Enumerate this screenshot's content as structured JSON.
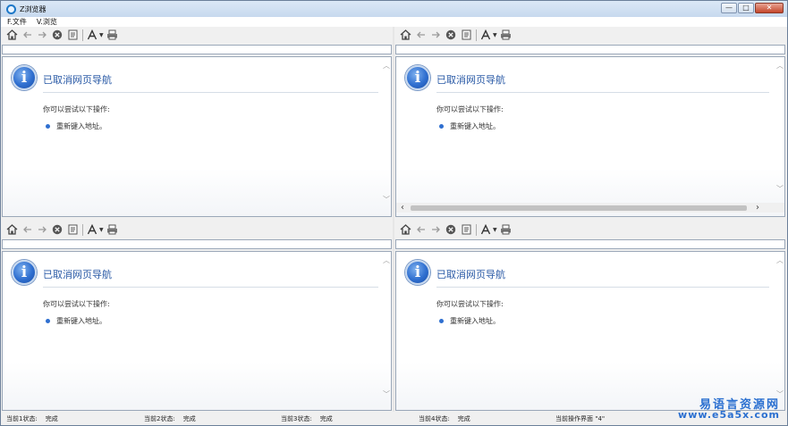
{
  "window": {
    "title": "Z浏览器",
    "buttons": {
      "minimize": "—",
      "maximize": "□",
      "close": "✕"
    }
  },
  "menubar": [
    {
      "label": "F.文件"
    },
    {
      "label": "V.浏览"
    }
  ],
  "panes": [
    {
      "message": {
        "title": "已取消网页导航",
        "hint": "你可以尝试以下操作:",
        "action": "重新键入地址。"
      }
    },
    {
      "message": {
        "title": "已取消网页导航",
        "hint": "你可以尝试以下操作:",
        "action": "重新键入地址。"
      }
    },
    {
      "message": {
        "title": "已取消网页导航",
        "hint": "你可以尝试以下操作:",
        "action": "重新键入地址。"
      }
    },
    {
      "message": {
        "title": "已取消网页导航",
        "hint": "你可以尝试以下操作:",
        "action": "重新键入地址。"
      }
    }
  ],
  "icons": {
    "home": "home-icon",
    "back": "back-arrow-icon",
    "forward": "forward-arrow-icon",
    "stop": "stop-icon",
    "page": "page-icon",
    "font": "font-size-icon",
    "print": "print-icon",
    "info": "info-icon"
  },
  "statusbar": [
    {
      "label": "当前1状态:",
      "value": "完成"
    },
    {
      "label": "当前2状态:",
      "value": "完成"
    },
    {
      "label": "当前3状态:",
      "value": "完成"
    },
    {
      "label": "当前4状态:",
      "value": "完成"
    },
    {
      "label": "当前操作界面",
      "value": "\"4\""
    }
  ],
  "watermark": {
    "line1": "易语言资源网",
    "line2": "www.e5a5x.com"
  },
  "colors": {
    "accent": "#2a5aa6",
    "info_blue": "#2f6fd0",
    "titlebar": "#c7d9ee"
  }
}
